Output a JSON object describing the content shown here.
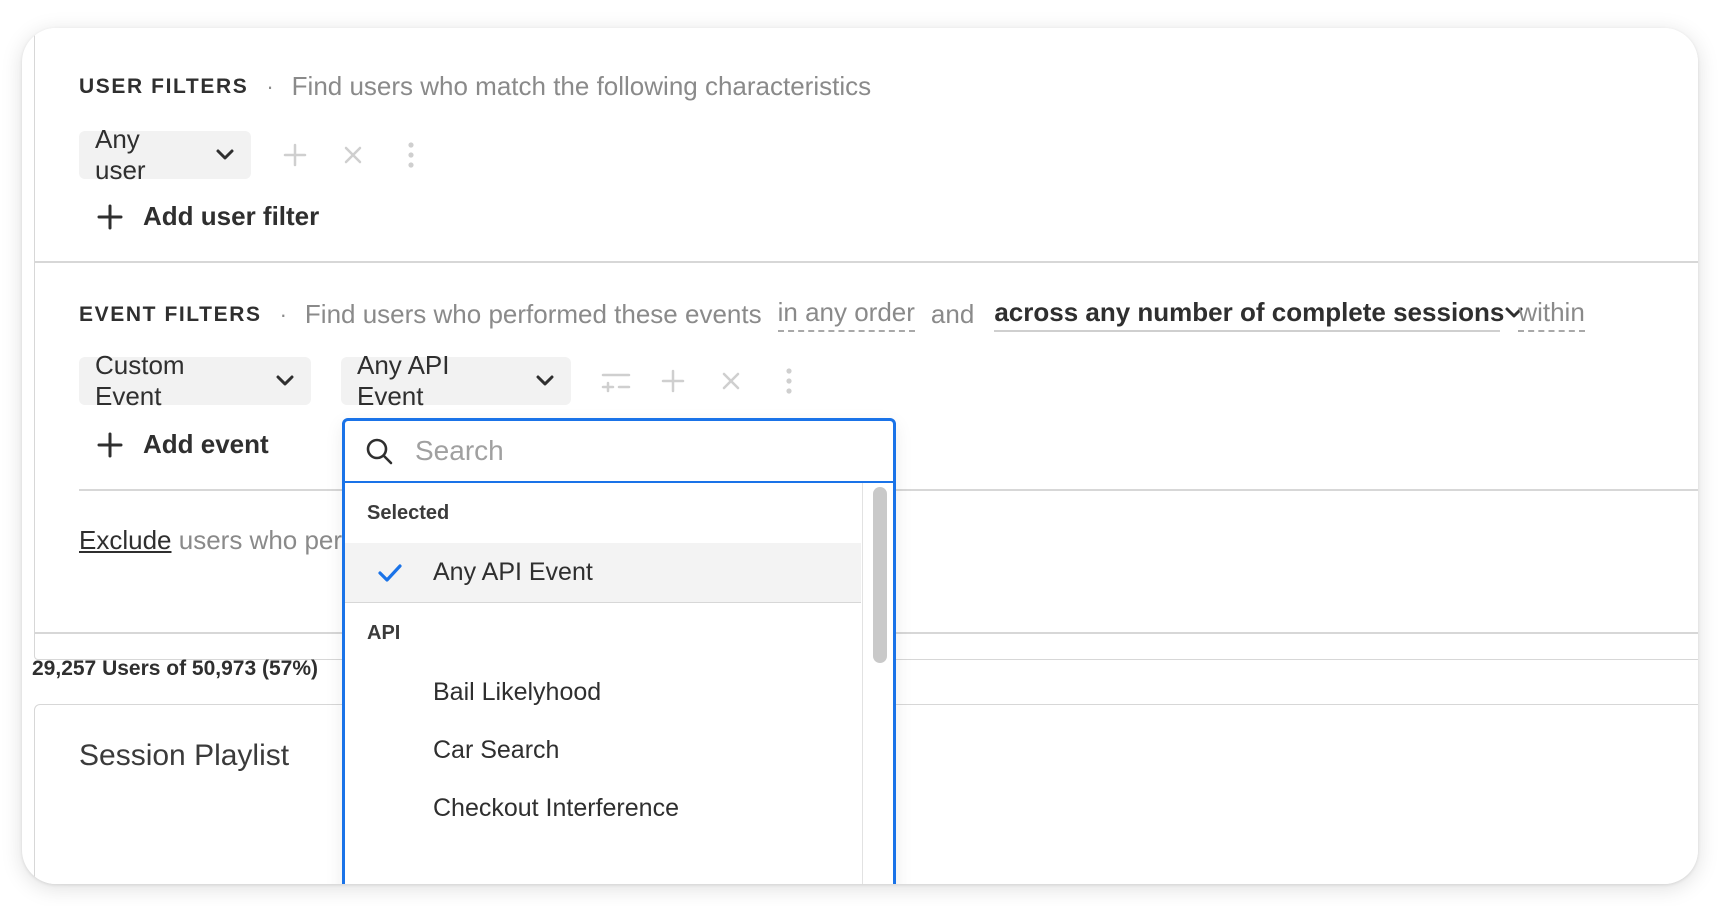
{
  "user_filters": {
    "title": "USER FILTERS",
    "separator": "·",
    "description": "Find users who match the following characteristics",
    "any_user_label": "Any user",
    "add_filter_label": "Add user filter"
  },
  "event_filters": {
    "title": "EVENT FILTERS",
    "separator": "·",
    "description": "Find users who performed these events",
    "order_label": "in any order",
    "and_label": "and",
    "sessions_label": "across any number of complete sessions",
    "within_label": "within",
    "event_type_label": "Custom Event",
    "event_value_label": "Any API Event",
    "add_event_label": "Add event"
  },
  "exclude": {
    "link_label": "Exclude",
    "rest_text": "users who perf"
  },
  "results": {
    "summary": "29,257 Users of 50,973 (57%)"
  },
  "playlist": {
    "title": "Session Playlist"
  },
  "dropdown": {
    "search_placeholder": "Search",
    "selected_group": "Selected",
    "selected_item": "Any API Event",
    "api_group": "API",
    "items": [
      "Bail Likelyhood",
      "Car Search",
      "Checkout Interference"
    ]
  },
  "colors": {
    "accent": "#1a73e8",
    "pill_bg": "#f2f2f2",
    "muted_text": "#8a8a8a"
  },
  "icons": {
    "chevron": "chevron-down-icon",
    "plus": "plus-icon",
    "close": "close-icon",
    "more": "more-vertical-icon",
    "branch": "split-icon",
    "search": "search-icon",
    "check": "check-icon"
  }
}
